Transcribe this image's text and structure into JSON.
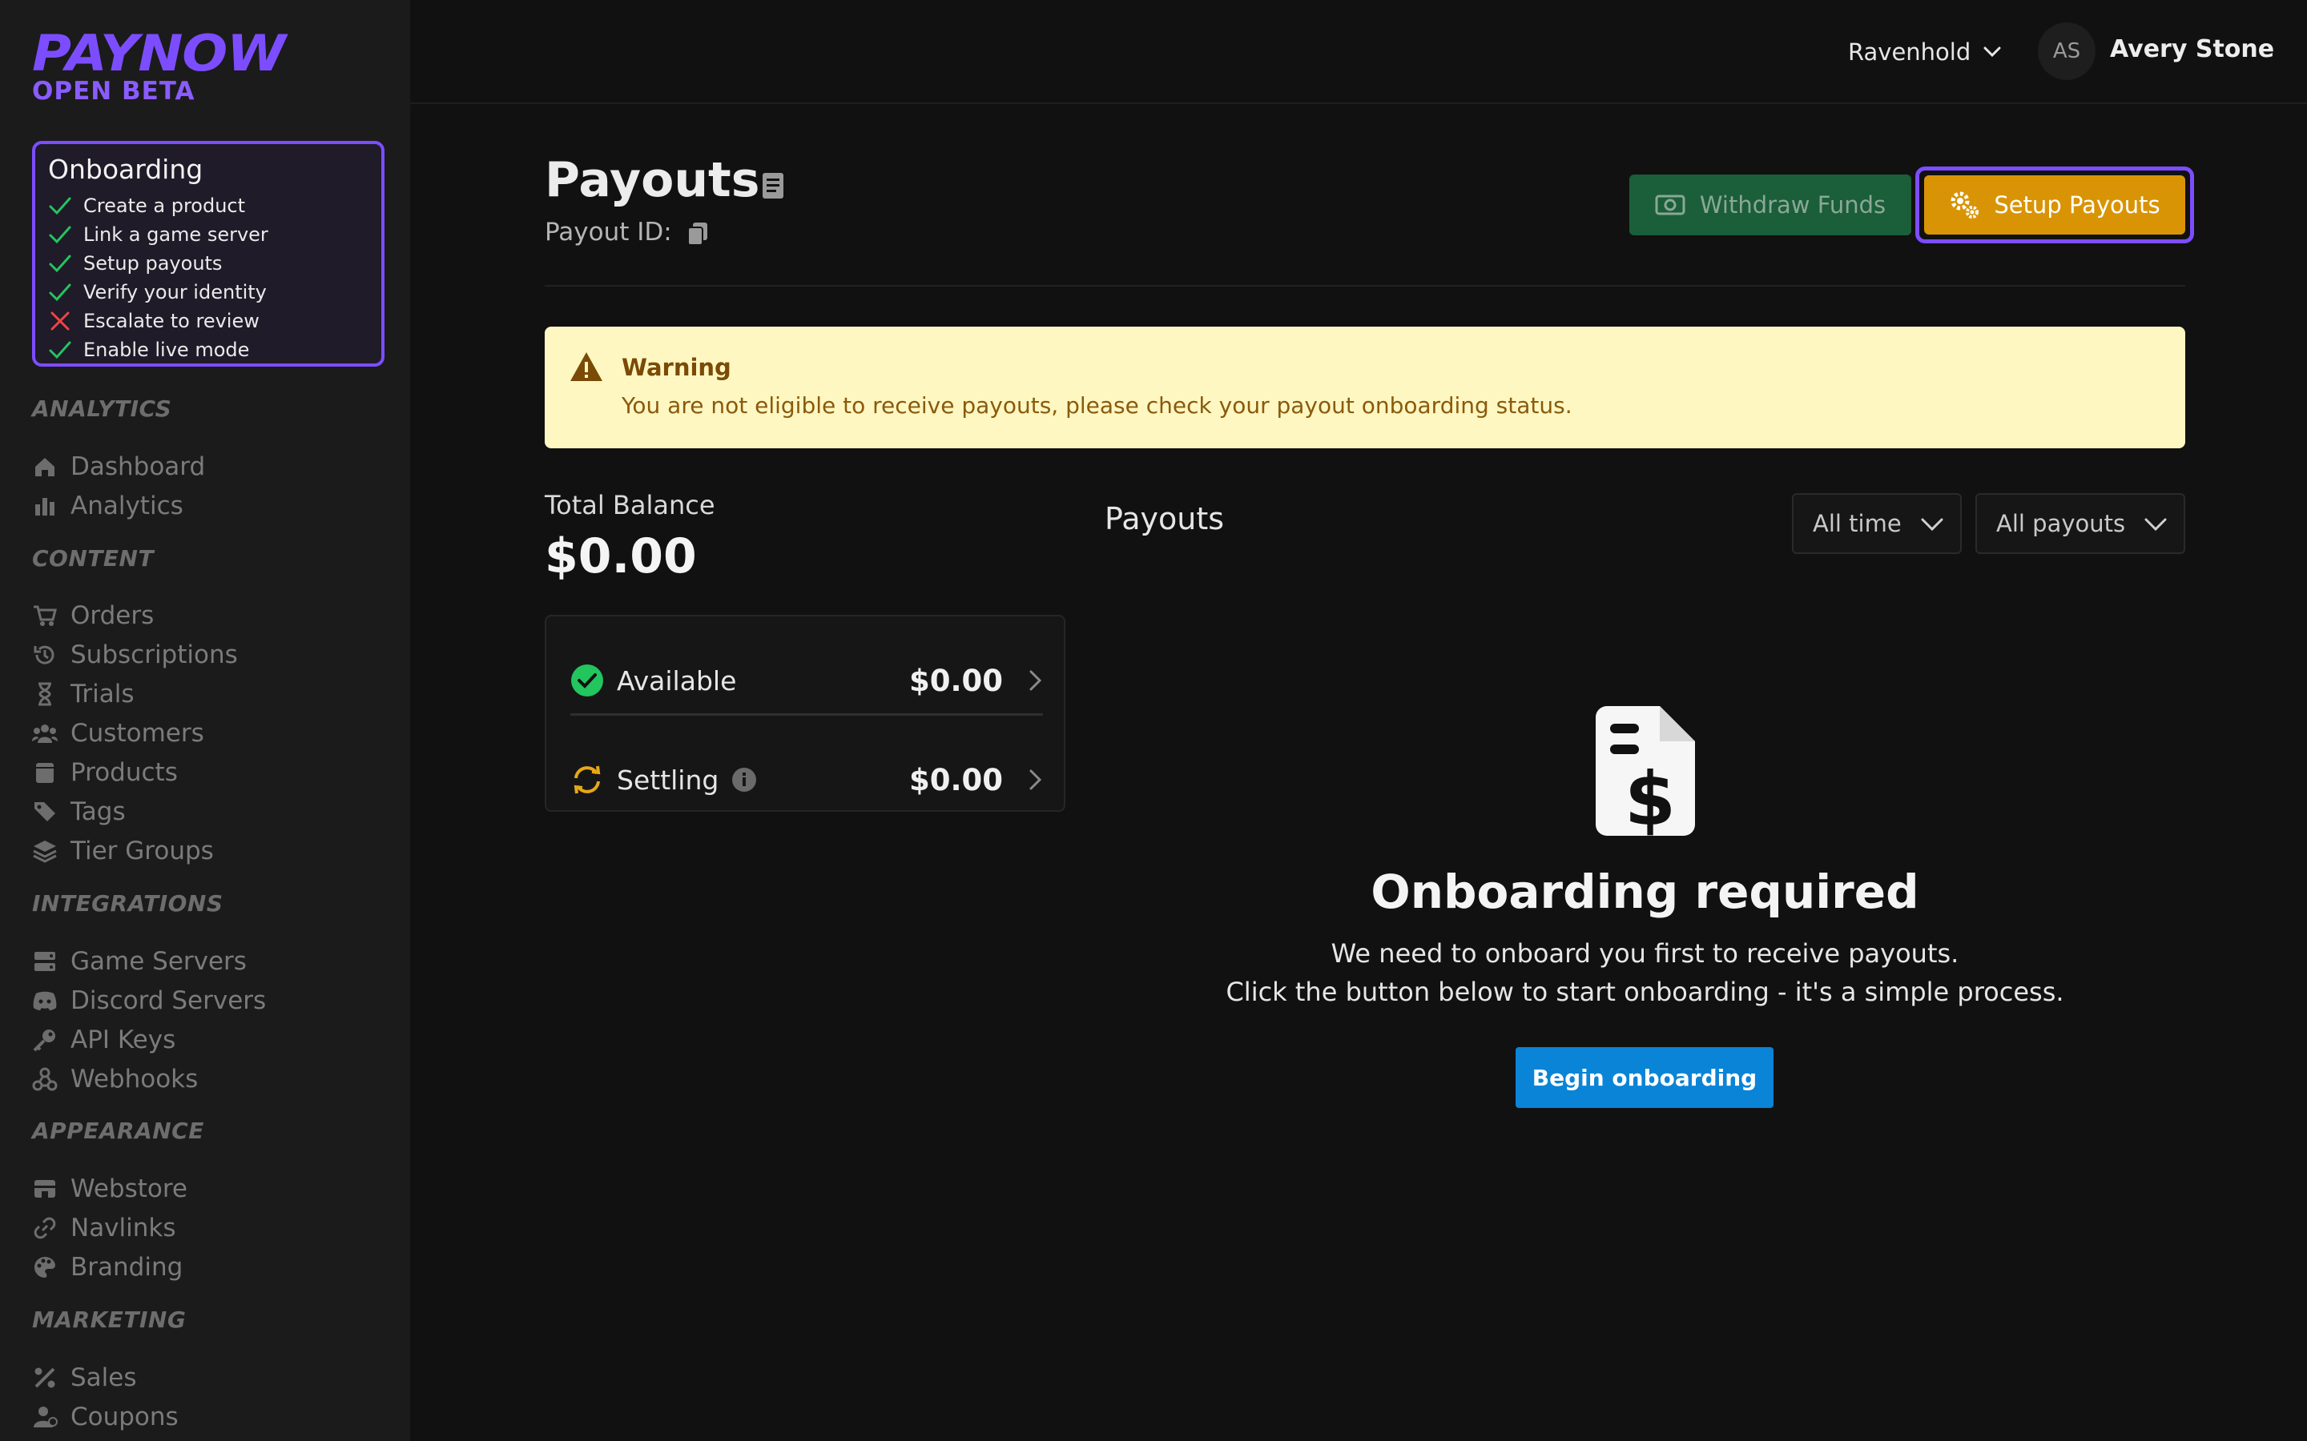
{
  "brand": {
    "name": "PAYNOW",
    "tag": "OPEN BETA",
    "accent": "#7c4dff"
  },
  "onboarding": {
    "title": "Onboarding",
    "items": [
      {
        "label": "Create a product",
        "done": true
      },
      {
        "label": "Link a game server",
        "done": true
      },
      {
        "label": "Setup payouts",
        "done": true
      },
      {
        "label": "Verify your identity",
        "done": true
      },
      {
        "label": "Escalate to review",
        "done": false
      },
      {
        "label": "Enable live mode",
        "done": true
      }
    ]
  },
  "sidebar": {
    "sections": [
      {
        "title": "ANALYTICS",
        "items": [
          "Dashboard",
          "Analytics"
        ]
      },
      {
        "title": "CONTENT",
        "items": [
          "Orders",
          "Subscriptions",
          "Trials",
          "Customers",
          "Products",
          "Tags",
          "Tier Groups"
        ]
      },
      {
        "title": "INTEGRATIONS",
        "items": [
          "Game Servers",
          "Discord Servers",
          "API Keys",
          "Webhooks"
        ]
      },
      {
        "title": "APPEARANCE",
        "items": [
          "Webstore",
          "Navlinks",
          "Branding"
        ]
      },
      {
        "title": "MARKETING",
        "items": [
          "Sales",
          "Coupons"
        ]
      }
    ]
  },
  "topbar": {
    "store": "Ravenhold",
    "avatar_initials": "AS",
    "user": "Avery Stone"
  },
  "header": {
    "title": "Payouts",
    "payout_id_label": "Payout ID:",
    "withdraw_label": "Withdraw Funds",
    "setup_label": "Setup Payouts"
  },
  "warning": {
    "title": "Warning",
    "message": "You are not eligible to receive payouts, please check your payout onboarding status."
  },
  "balance": {
    "label": "Total Balance",
    "total": "$0.00",
    "available_label": "Available",
    "available_amount": "$0.00",
    "settling_label": "Settling",
    "settling_amount": "$0.00"
  },
  "payouts": {
    "heading": "Payouts",
    "filter_time": "All time",
    "filter_type": "All payouts",
    "empty_title": "Onboarding required",
    "empty_line1": "We need to onboard you first to receive payouts.",
    "empty_line2": "Click the button below to start onboarding - it's a simple process.",
    "begin_label": "Begin onboarding"
  }
}
